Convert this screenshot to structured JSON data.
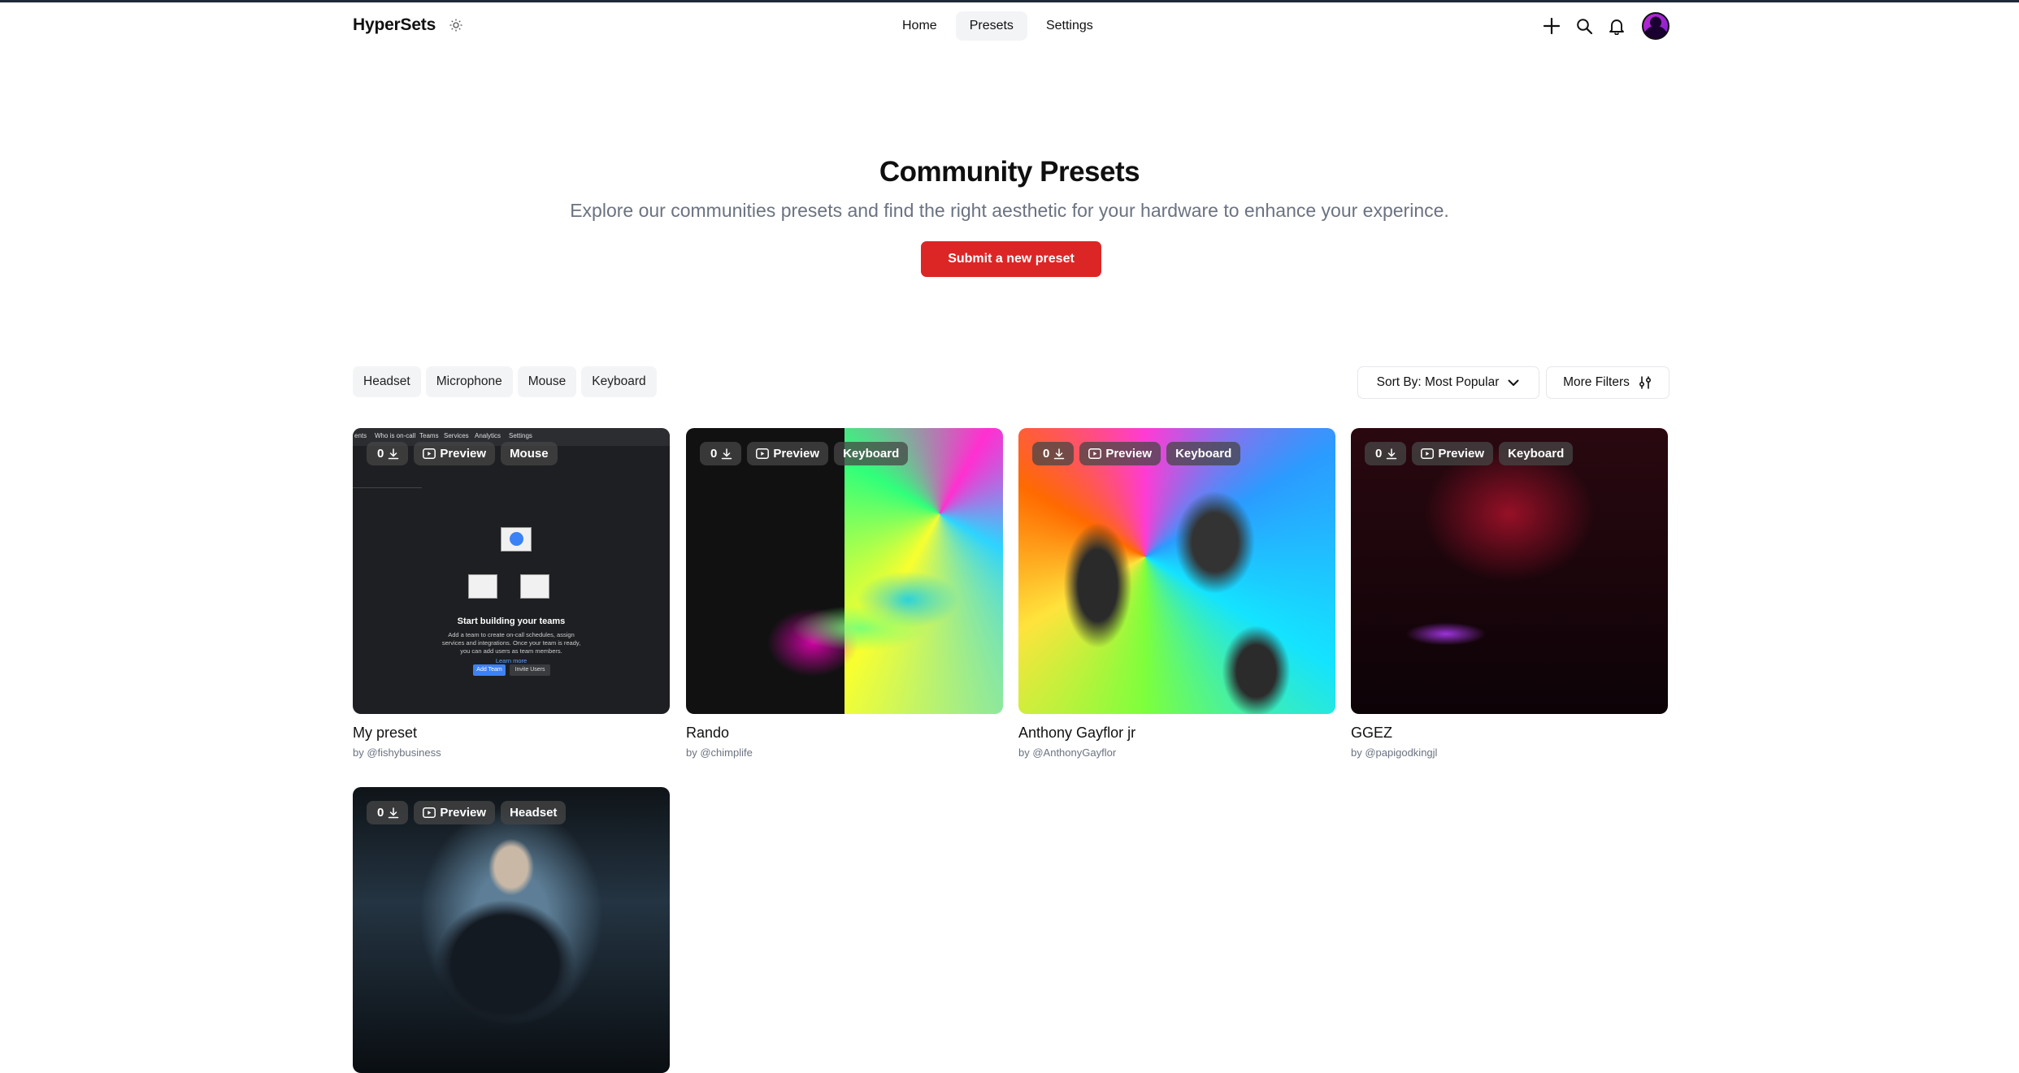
{
  "header": {
    "brand": "HyperSets",
    "nav": [
      {
        "label": "Home"
      },
      {
        "label": "Presets",
        "active": true
      },
      {
        "label": "Settings"
      }
    ],
    "icons": [
      "sun-icon",
      "plus-icon",
      "search-icon",
      "bell-icon",
      "avatar"
    ]
  },
  "hero": {
    "title": "Community Presets",
    "subtitle": "Explore our communities presets and find the right aesthetic for your hardware to enhance your experince.",
    "cta": "Submit a new preset"
  },
  "filters": {
    "chips": [
      "Headset",
      "Microphone",
      "Mouse",
      "Keyboard"
    ],
    "sort_label": "Sort By: Most Popular",
    "more_filters_label": "More Filters"
  },
  "cards": [
    {
      "title": "My preset",
      "author": "by @fishybusiness",
      "count": "0",
      "preview": "Preview",
      "category": "Mouse",
      "thumb": {
        "nav": [
          "ents",
          "Who is on-call",
          "Teams",
          "Services",
          "Analytics",
          "Settings"
        ],
        "heading": "Start building your teams",
        "body": "Add a team to create on-call schedules, assign services and integrations. Once your team is ready, you can add users as team members.",
        "link": "Learn more",
        "btn_primary": "Add Team",
        "btn_secondary": "Invite Users"
      }
    },
    {
      "title": "Rando",
      "author": "by @chimplife",
      "count": "0",
      "preview": "Preview",
      "category": "Keyboard"
    },
    {
      "title": "Anthony Gayflor jr",
      "author": "by @AnthonyGayflor",
      "count": "0",
      "preview": "Preview",
      "category": "Keyboard"
    },
    {
      "title": "GGEZ",
      "author": "by @papigodkingjl",
      "count": "0",
      "preview": "Preview",
      "category": "Keyboard"
    },
    {
      "title": "",
      "author": "",
      "count": "0",
      "preview": "Preview",
      "category": "Headset"
    }
  ],
  "colors": {
    "accent": "#dc2626",
    "chip_bg": "#f3f4f6",
    "muted_text": "#6b7280"
  }
}
